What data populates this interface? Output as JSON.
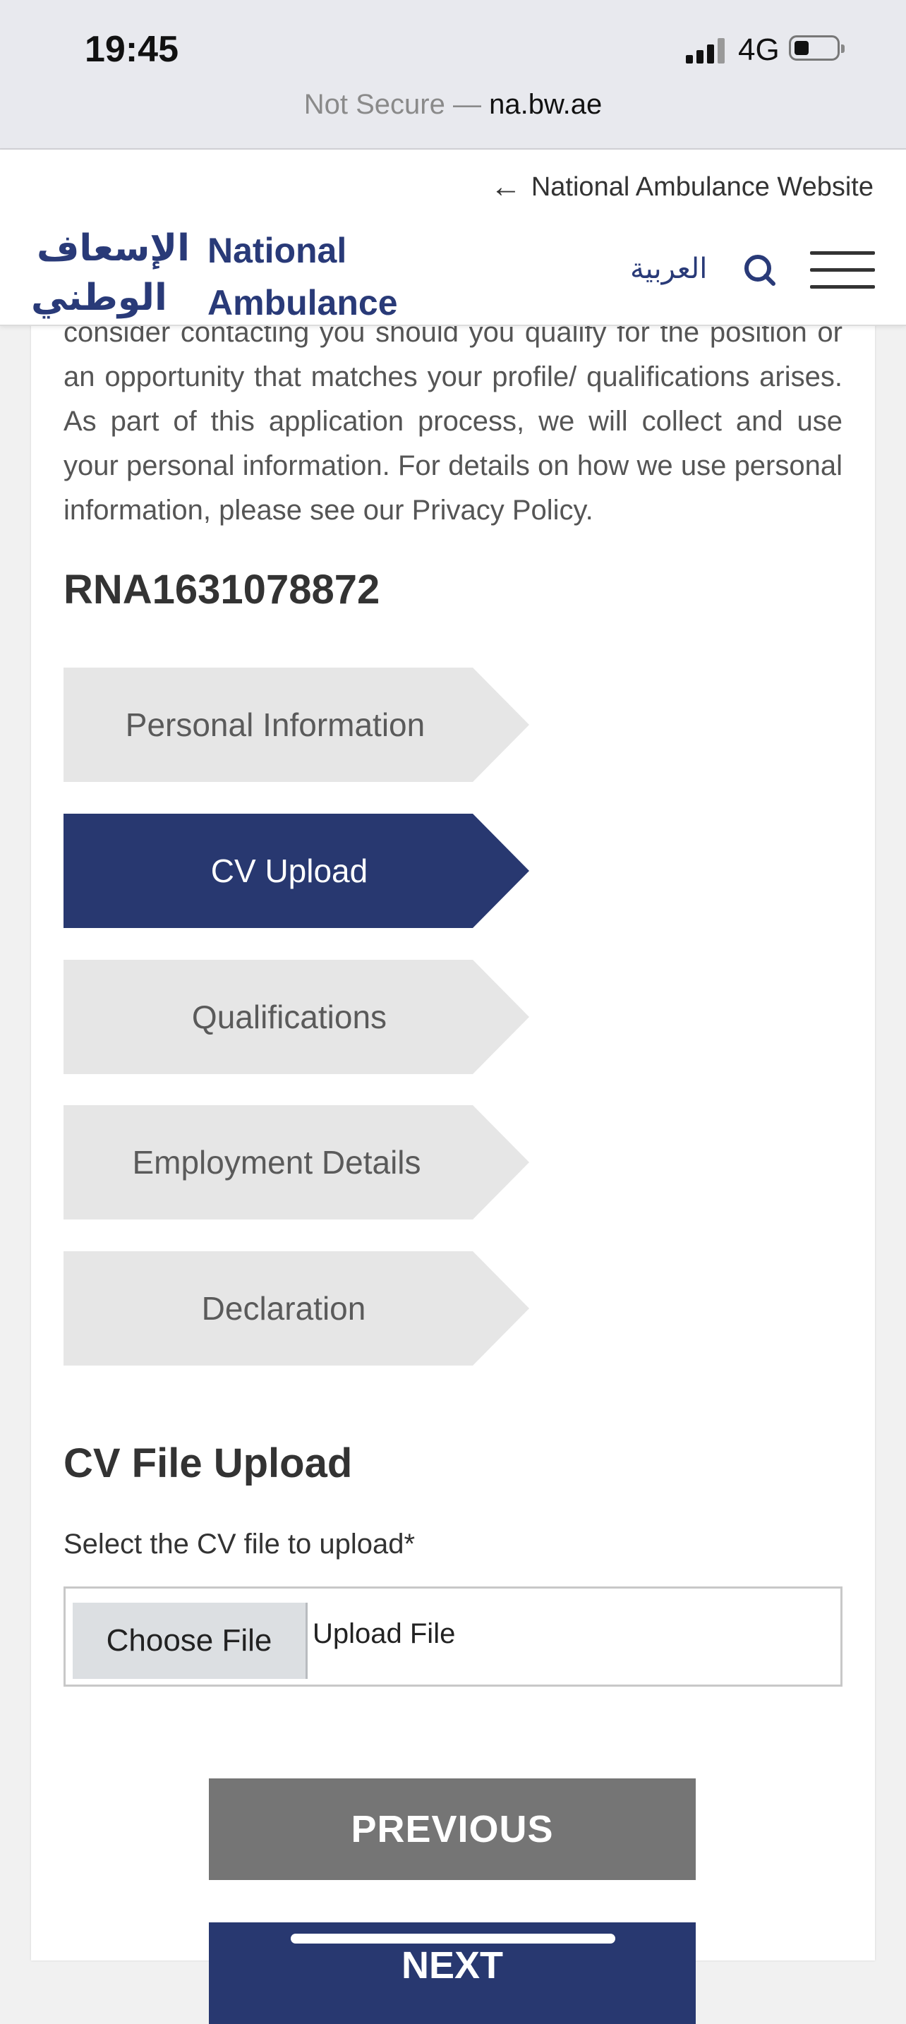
{
  "status_bar": {
    "time": "19:45",
    "network": "4G"
  },
  "address_bar": {
    "security_label": "Not Secure —",
    "domain": "na.bw.ae"
  },
  "header": {
    "back_link": "National Ambulance Website",
    "logo": {
      "arabic_line1": "الإسعاف",
      "arabic_line2": "الوطني",
      "english_line1": "National",
      "english_line2": "Ambulance"
    },
    "language_toggle": "العربية",
    "search_icon": "search-icon",
    "menu_icon": "hamburger-menu-icon",
    "brand_color": "#283870"
  },
  "intro_text": "consider contacting you should you qualify for the position or an opportunity that matches your profile/ qualifications arises. As part of this application process, we will collect and use your personal information. For details on how we use personal information, please see our Privacy Policy.",
  "reference_number": "RNA1631078872",
  "steps": [
    {
      "label": "Personal Information",
      "active": false
    },
    {
      "label": "CV Upload",
      "active": true
    },
    {
      "label": "Qualifications",
      "active": false
    },
    {
      "label": "Employment Details",
      "active": false
    },
    {
      "label": "Declaration",
      "active": false
    }
  ],
  "cv_upload": {
    "heading": "CV File Upload",
    "field_label": "Select the CV file to upload*",
    "choose_button": "Choose File",
    "file_status": "Upload File"
  },
  "buttons": {
    "previous": "PREVIOUS",
    "next": "NEXT"
  }
}
